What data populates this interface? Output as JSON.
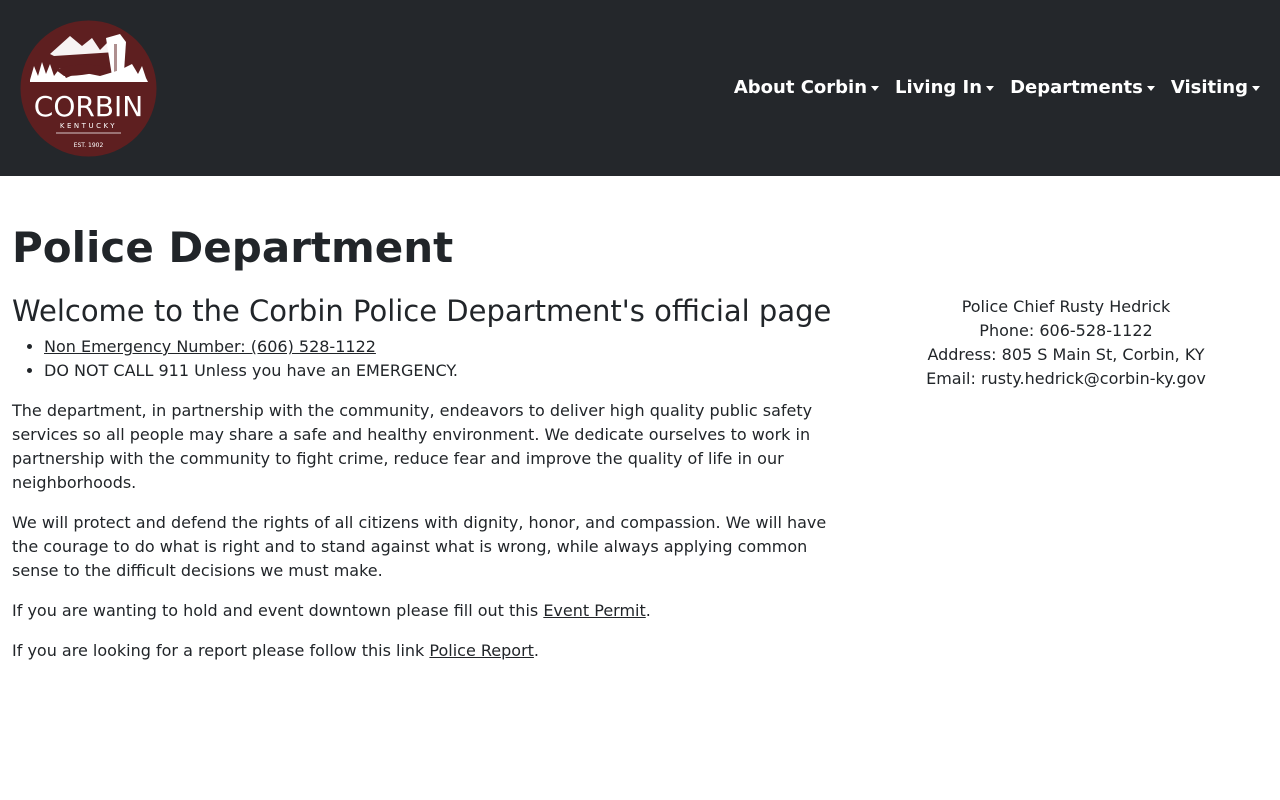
{
  "header": {
    "logo": {
      "city": "CORBIN",
      "state": "KENTUCKY",
      "established": "EST. 1902",
      "brand_color": "#5e1f20"
    },
    "nav": [
      {
        "label": "About Corbin"
      },
      {
        "label": "Living In"
      },
      {
        "label": "Departments"
      },
      {
        "label": "Visiting"
      }
    ],
    "bg_color": "#24272b"
  },
  "page": {
    "title": "Police Department",
    "welcome": "Welcome to the Corbin Police Department's official page",
    "bullets": {
      "non_emergency": "Non Emergency Number: (606) 528-1122",
      "emergency": "DO NOT CALL 911 Unless you have an EMERGENCY."
    },
    "paragraph1": "The department, in partnership with the community, endeavors to deliver high quality public safety services so all people may share a safe and healthy environment. We dedicate ourselves to work in partnership with the community to fight crime, reduce fear and improve the quality of life in our neighborhoods.",
    "paragraph2": "We will protect and defend the rights of all citizens with dignity, honor, and compassion. We will have the courage to do what is right and to stand against what is wrong, while always applying common sense to the difficult decisions we must make.",
    "event": {
      "text": "If you are wanting to hold and event downtown please fill out this ",
      "link": "Event Permit",
      "end": "."
    },
    "report": {
      "text": "If you are looking for a report please follow this link ",
      "link": "Police Report",
      "end": "."
    }
  },
  "contact": {
    "chief": "Police Chief Rusty Hedrick",
    "phone": "Phone: 606-528-1122",
    "address": "Address: 805 S Main St, Corbin, KY",
    "email": "Email: rusty.hedrick@corbin-ky.gov"
  }
}
